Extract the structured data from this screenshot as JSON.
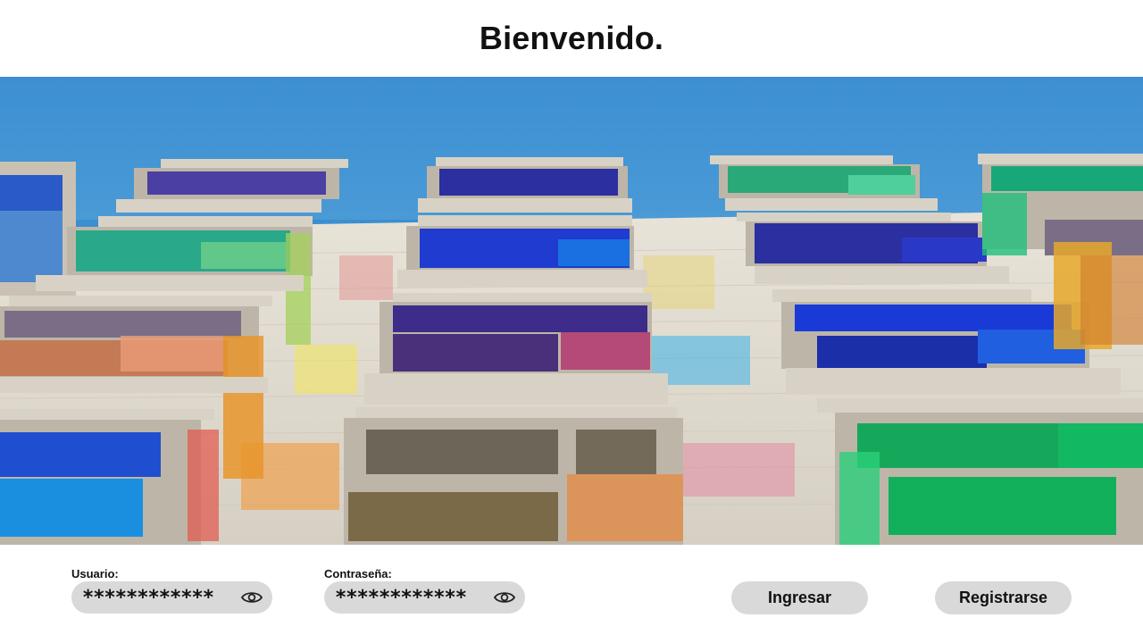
{
  "header": {
    "title": "Bienvenido."
  },
  "hero": {
    "image": "colorful-glass-balconies-building-photo"
  },
  "form": {
    "username": {
      "label": "Usuario:",
      "value": "************",
      "toggle_icon": "eye-icon"
    },
    "password": {
      "label": "Contraseña:",
      "value": "************",
      "toggle_icon": "eye-icon"
    },
    "login_button": "Ingresar",
    "register_button": "Registrarse"
  },
  "colors": {
    "pill_background": "#d9d9d9",
    "sky": "#3a8fd0",
    "text": "#111111"
  }
}
